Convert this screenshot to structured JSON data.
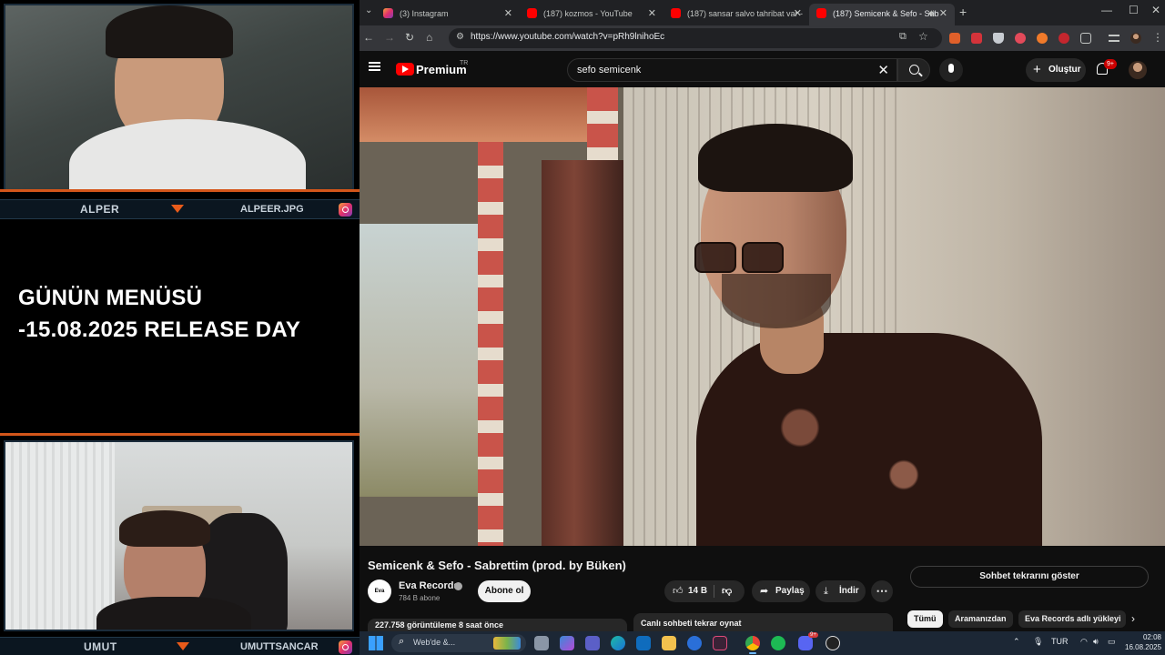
{
  "overlay": {
    "top_cam": {
      "left_name": "ALPER",
      "right_name": "ALPEER.JPG"
    },
    "menu_lines": [
      "GÜNÜN MENÜSÜ",
      "-15.08.2025 RELEASE DAY"
    ],
    "bottom_cam": {
      "left_name": "UMUT",
      "right_name": "UMUTTSANCAR"
    }
  },
  "browser": {
    "tabs": [
      {
        "label": "(3) Instagram",
        "icon": "instagram-icon"
      },
      {
        "label": "(187) kozmos - YouTube",
        "icon": "youtube-icon"
      },
      {
        "label": "(187) sansar salvo tahribat var -",
        "icon": "youtube-icon"
      },
      {
        "label": "(187) Semicenk & Sefo - Sab",
        "icon": "youtube-icon",
        "active": true
      }
    ],
    "url": "https://www.youtube.com/watch?v=pRh9lnihoEc"
  },
  "youtube": {
    "brand": "Premium",
    "country": "TR",
    "search_query": "sefo semicenk",
    "create_label": "Oluştur",
    "notif_count": "9+",
    "video": {
      "title": "Semicenk & Sefo - Sabrettim (prod. by Büken)",
      "channel": "Eva Records",
      "channel_avatar_text": "Eva",
      "subscribers": "784 B abone",
      "subscribe_label": "Abone ol",
      "likes": "14 B",
      "share_label": "Paylaş",
      "download_label": "İndir",
      "views": "227.758 görüntüleme  8 saat önce",
      "live_chat_bar": "Canlı sohbeti tekrar oynat"
    },
    "chat_toggle": "Sohbet tekrarını göster",
    "chips": [
      "Tümü",
      "Aramanızdan",
      "Eva Records adlı yükleyi"
    ]
  },
  "taskbar": {
    "search_text": "Web'de &...",
    "language": "TUR",
    "time": "02:08",
    "date": "16.08.2025",
    "discord_badge": "9+"
  },
  "colors": {
    "accent_orange": "#e85b1a",
    "youtube_red": "#ff0000",
    "yt_bg": "#0f0f0f"
  }
}
